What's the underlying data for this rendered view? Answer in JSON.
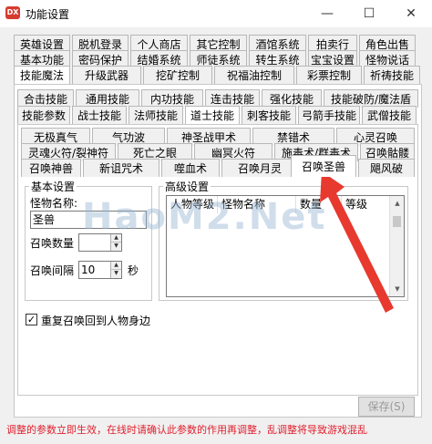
{
  "window": {
    "title": "功能设置",
    "app_icon_text": "DX",
    "minimize": "—",
    "maximize": "☐",
    "close": "✕"
  },
  "tabs_row1": [
    "英雄设置",
    "脱机登录",
    "个人商店",
    "其它控制",
    "酒馆系统",
    "拍卖行",
    "角色出售"
  ],
  "tabs_row2": [
    "基本功能",
    "密码保护",
    "结婚系统",
    "师徒系统",
    "转生系统",
    "宝宝设置",
    "怪物说话"
  ],
  "tabs_row3": [
    "技能魔法",
    "升级武器",
    "挖矿控制",
    "祝福油控制",
    "彩票控制",
    "祈祷技能"
  ],
  "tabs_row4": [
    "合击技能",
    "通用技能",
    "内功技能",
    "连击技能",
    "强化技能",
    "技能破防/魔法盾"
  ],
  "tabs_row5": [
    "技能参数",
    "战士技能",
    "法师技能",
    "道士技能",
    "刺客技能",
    "弓箭手技能",
    "武僧技能"
  ],
  "tabs_row6": [
    "无极真气",
    "气功波",
    "神圣战甲术",
    "禁错术",
    "心灵召唤"
  ],
  "tabs_row7": [
    "灵魂火符/裂神符",
    "死亡之眼",
    "幽冥火符",
    "施毒术/群毒术",
    "召唤骷髅"
  ],
  "tabs_row8": [
    "召唤神兽",
    "新诅咒术",
    "噬血术",
    "召唤月灵",
    "召唤圣兽",
    "飓风破"
  ],
  "basic": {
    "group_label": "基本设置",
    "monster_name_label": "怪物名称:",
    "monster_name_value": "圣兽",
    "summon_count_label": "召唤数量",
    "summon_count_value": "",
    "summon_interval_label": "召唤间隔",
    "summon_interval_value": "10",
    "seconds_unit": "秒"
  },
  "advanced": {
    "group_label": "高级设置",
    "columns": [
      "人物等级",
      "怪物名称",
      "数量",
      "等级"
    ]
  },
  "recall": {
    "checked": true,
    "label": "重复召唤回到人物身边"
  },
  "save_button": "保存(S)",
  "notice": "调整的参数立即生效，在线时请确认此参数的作用再调整，乱调整将导致游戏混乱",
  "watermark": "HaoM2.Net"
}
